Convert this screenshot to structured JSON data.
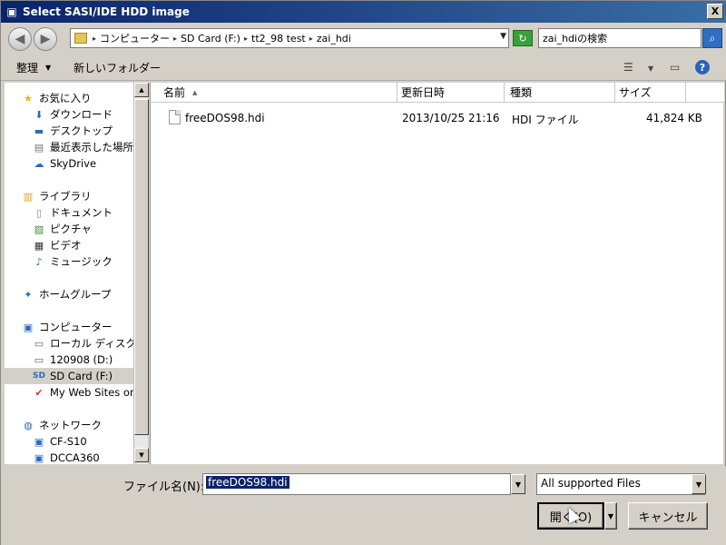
{
  "window": {
    "title": "Select SASI/IDE HDD image",
    "close": "X"
  },
  "nav": {
    "back_icon": "back-arrow-icon",
    "forward_icon": "forward-arrow-icon",
    "address": [
      "コンピューター",
      "SD Card (F:)",
      "tt2_98 test",
      "zai_hdi"
    ],
    "search_placeholder": "zai_hdiの検索"
  },
  "commands": {
    "organize": "整理",
    "new_folder": "新しいフォルダー"
  },
  "sidebar": {
    "favorites": {
      "label": "お気に入り",
      "items": [
        "ダウンロード",
        "デスクトップ",
        "最近表示した場所",
        "SkyDrive"
      ]
    },
    "libraries": {
      "label": "ライブラリ",
      "items": [
        "ドキュメント",
        "ピクチャ",
        "ビデオ",
        "ミュージック"
      ]
    },
    "homegroup": {
      "label": "ホームグループ"
    },
    "computer": {
      "label": "コンピューター",
      "items": [
        "ローカル ディスク (C",
        "120908 (D:)",
        "SD Card (F:)",
        "My Web Sites on"
      ]
    },
    "network": {
      "label": "ネットワーク",
      "items": [
        "CF-S10",
        "DCCA360"
      ]
    }
  },
  "columns": [
    "名前",
    "更新日時",
    "種類",
    "サイズ"
  ],
  "files": [
    {
      "name": "freeDOS98.hdi",
      "modified": "2013/10/25 21:16",
      "type": "HDI ファイル",
      "size": "41,824 KB"
    }
  ],
  "footer": {
    "filename_label": "ファイル名(N):",
    "filename_value": "freeDOS98.hdi",
    "filter_value": "All supported Files",
    "open_label": "開く(O)",
    "cancel_label": "キャンセル"
  }
}
